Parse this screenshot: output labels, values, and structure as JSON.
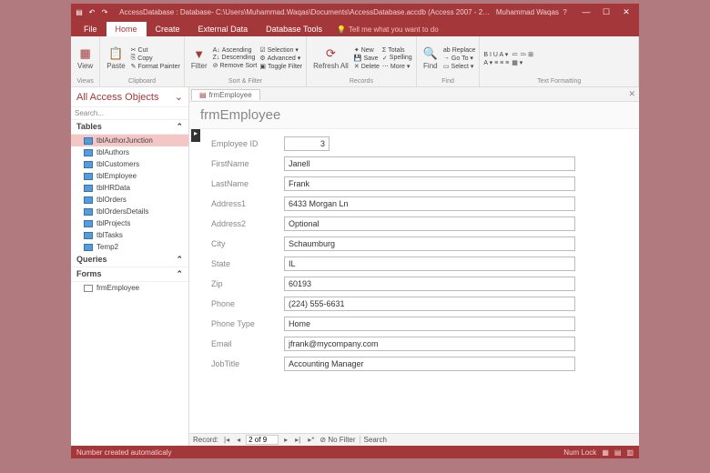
{
  "titlebar": {
    "title": "AccessDatabase : Database- C:\\Users\\Muhammad.Waqas\\Documents\\AccessDatabase.accdb (Access 2007 - 2…",
    "user": "Muhammad Waqas"
  },
  "tabs": [
    "File",
    "Home",
    "Create",
    "External Data",
    "Database Tools"
  ],
  "tell": "Tell me what you want to do",
  "ribbon": {
    "views": {
      "label": "Views",
      "btn": "View"
    },
    "clipboard": {
      "label": "Clipboard",
      "btn": "Paste",
      "items": [
        "Cut",
        "Copy",
        "Format Painter"
      ]
    },
    "sort": {
      "label": "Sort & Filter",
      "btn": "Filter",
      "items": [
        "Ascending",
        "Descending",
        "Remove Sort"
      ],
      "items2": [
        "Selection ▾",
        "Advanced ▾",
        "Toggle Filter"
      ]
    },
    "records": {
      "label": "Records",
      "btn": "Refresh All",
      "items": [
        "New",
        "Save",
        "Delete"
      ],
      "items2": [
        "Totals",
        "Spelling",
        "More ▾"
      ]
    },
    "find": {
      "label": "Find",
      "btn": "Find",
      "items": [
        "Replace",
        "Go To ▾",
        "Select ▾"
      ]
    },
    "textfmt": {
      "label": "Text Formatting"
    }
  },
  "nav": {
    "head": "All Access Objects",
    "search": "Search...",
    "cats": [
      {
        "name": "Tables",
        "items": [
          "tblAuthorJunction",
          "tblAuthors",
          "tblCustomers",
          "tblEmployee",
          "tblHRData",
          "tblOrders",
          "tblOrdersDetails",
          "tblProjects",
          "tblTasks",
          "Temp2"
        ],
        "sel": 0
      },
      {
        "name": "Queries",
        "items": []
      },
      {
        "name": "Forms",
        "items": [
          "frmEmployee"
        ],
        "frm": true
      }
    ]
  },
  "doctab": "frmEmployee",
  "formTitle": "frmEmployee",
  "fields": [
    {
      "label": "Employee ID",
      "value": "3",
      "id": true
    },
    {
      "label": "FirstName",
      "value": "Janell"
    },
    {
      "label": "LastName",
      "value": "Frank"
    },
    {
      "label": "Address1",
      "value": "6433 Morgan Ln"
    },
    {
      "label": "Address2",
      "value": "Optional"
    },
    {
      "label": "City",
      "value": "Schaumburg"
    },
    {
      "label": "State",
      "value": "IL"
    },
    {
      "label": "Zip",
      "value": "60193"
    },
    {
      "label": "Phone",
      "value": "(224) 555-6631"
    },
    {
      "label": "Phone Type",
      "value": "Home"
    },
    {
      "label": "Email",
      "value": "jfrank@mycompany.com"
    },
    {
      "label": "JobTitle",
      "value": "Accounting Manager"
    }
  ],
  "recnav": {
    "label": "Record:",
    "pos": "2 of 9",
    "nofilter": "No Filter",
    "search": "Search"
  },
  "status": {
    "left": "Number created automaticaly",
    "right": "Num Lock"
  }
}
